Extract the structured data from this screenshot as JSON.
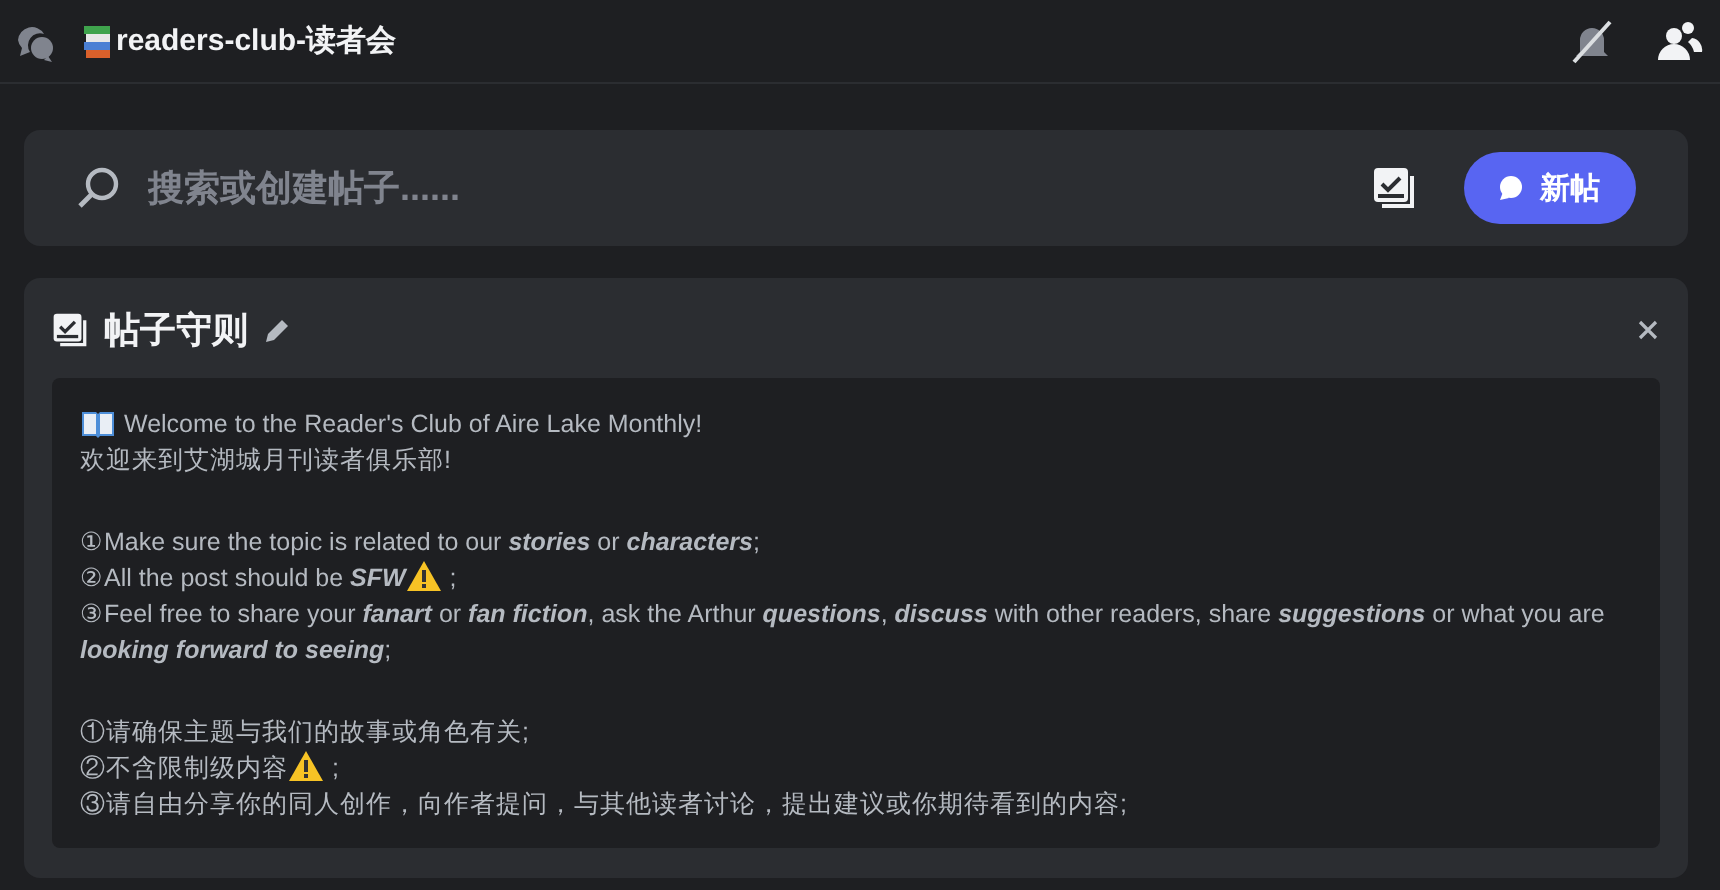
{
  "header": {
    "channel_name": "readers-club-读者会",
    "notifications_muted": true
  },
  "search": {
    "placeholder": "搜索或创建帖子......",
    "new_post_label": "新帖"
  },
  "guidelines": {
    "title": "帖子守则",
    "lines": [
      {
        "kind": "book_lead",
        "after": "Welcome to the Reader's Club of Aire Lake Monthly!"
      },
      {
        "kind": "plain",
        "before": "欢迎来到艾湖城月刊读者俱乐部!"
      },
      {
        "kind": "blank"
      },
      {
        "kind": "plain",
        "before": "①Make sure the topic is related to our **stories** or **characters**;"
      },
      {
        "kind": "warning_mid",
        "before": "②All the post should be **SFW**",
        "after": ";"
      },
      {
        "kind": "plain",
        "before": "③Feel free to share your **fanart** or **fan fiction**, ask the Arthur **questions**, **discuss** with other readers, share **suggestions** or what you are **looking forward to seeing**;"
      },
      {
        "kind": "blank"
      },
      {
        "kind": "plain",
        "before": "①请确保主题与我们的故事或角色有关;"
      },
      {
        "kind": "warning_mid",
        "before": "②不含限制级内容",
        "after": ";"
      },
      {
        "kind": "plain",
        "before": "③请自由分享你的同人创作，向作者提问，与其他读者讨论，提出建议或你期待看到的内容;"
      }
    ]
  }
}
